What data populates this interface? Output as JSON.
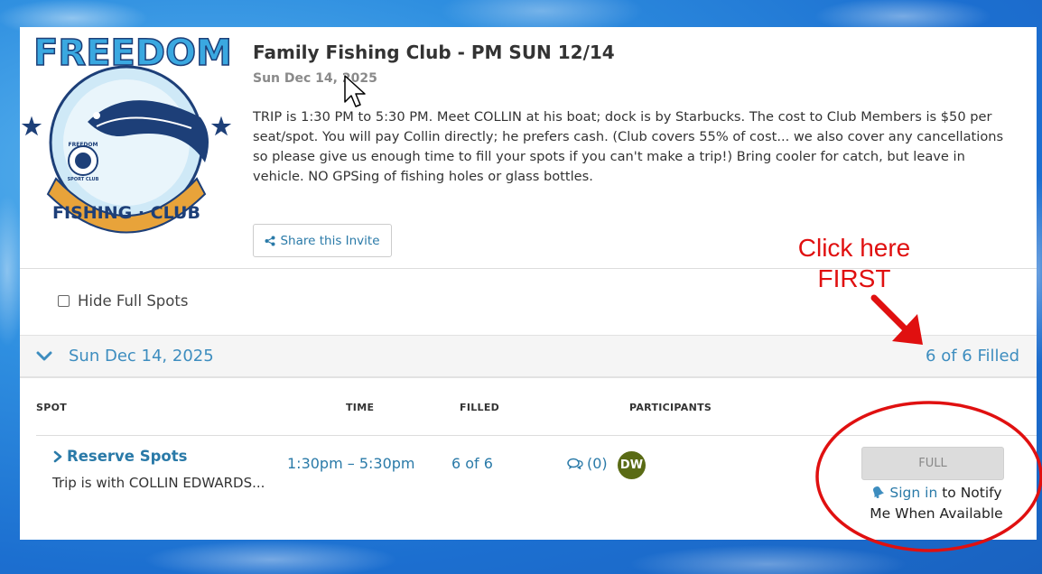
{
  "event": {
    "title": "Family Fishing Club - PM SUN 12/14",
    "date": "Sun Dec 14, 2025",
    "description": "TRIP is 1:30 PM to 5:30 PM. Meet COLLIN at his boat; dock is by Starbucks. The cost to Club Members is $50 per seat/spot. You will pay Collin directly; he prefers cash. (Club covers 55% of cost... we also cover any cancellations so please give us enough time to fill your spots if you can't make a trip!) Bring cooler for catch, but leave in vehicle. NO GPSing of fishing holes or glass bottles."
  },
  "logo": {
    "top_text": "FREEDOM",
    "bottom_text": "FISHING · CLUB",
    "badge_text_top": "FREEDOM",
    "badge_text_bottom": "SPORT CLUB"
  },
  "share": {
    "label": "Share this Invite",
    "icon": "share-icon"
  },
  "filter": {
    "hide_full_label": "Hide Full Spots",
    "checked": false
  },
  "date_group": {
    "label": "Sun Dec 14, 2025",
    "filled_summary": "6 of 6 Filled"
  },
  "columns": {
    "spot": "SPOT",
    "time": "TIME",
    "filled": "FILLED",
    "participants": "PARTICIPANTS"
  },
  "row": {
    "reserve_label": "Reserve Spots",
    "description": "Trip is with COLLIN EDWARDS...",
    "time": "1:30pm – 5:30pm",
    "filled": "6 of 6",
    "comments": "(0)",
    "avatar_initials": "DW",
    "avatar_color": "#5a6b15",
    "status_button": "FULL",
    "signin_link": "Sign in",
    "notify_text_1": "to Notify",
    "notify_text_2": "Me When Available"
  },
  "annotation": {
    "line1": "Click here",
    "line2": "FIRST",
    "color": "#e01010"
  },
  "colors": {
    "link": "#2a7aa8",
    "accent": "#3d8dbf",
    "logo_blue": "#1d3f78",
    "logo_gold": "#e8a33a"
  }
}
